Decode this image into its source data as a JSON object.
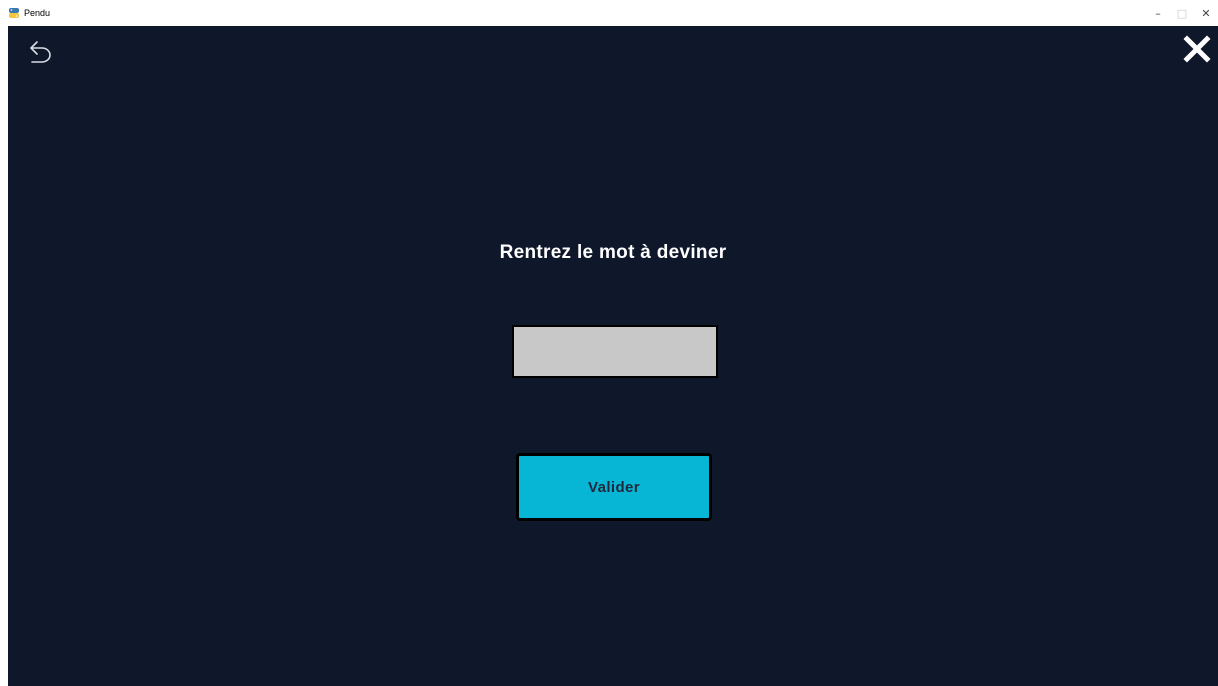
{
  "window": {
    "title": "Pendu",
    "icon": "python-icon",
    "controls": {
      "minimize": "–",
      "maximize": "□",
      "close": "✕"
    }
  },
  "toolbar": {
    "back_icon": "undo-arrow-icon",
    "close_icon": "close-x-icon"
  },
  "form": {
    "prompt": "Rentrez le mot à deviner",
    "word_value": "",
    "submit_label": "Valider"
  },
  "colors": {
    "background": "#0f172a",
    "input_bg": "#c8c8c8",
    "button_bg": "#06b6d4",
    "button_text": "#1e293b",
    "text": "#ffffff"
  }
}
